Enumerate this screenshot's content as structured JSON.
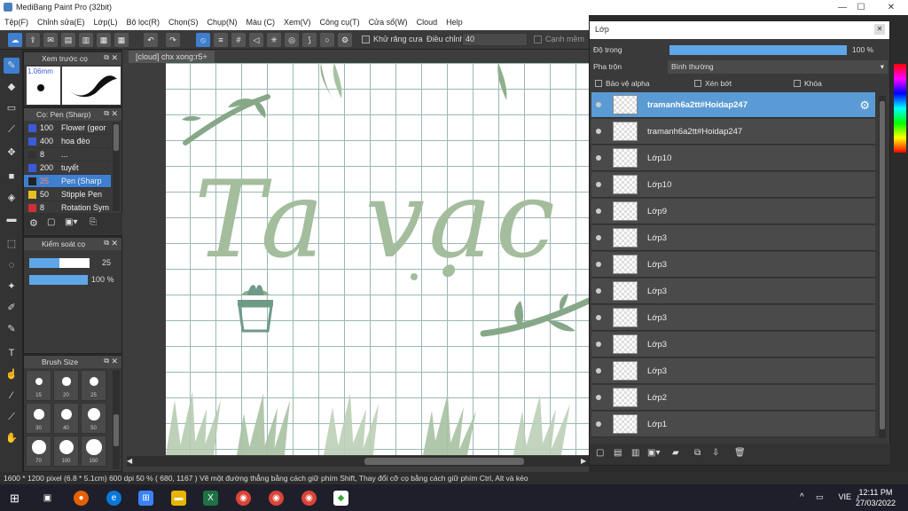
{
  "window": {
    "title": "MediBang Paint Pro (32bit)"
  },
  "menu": [
    "Tệp(F)",
    "Chỉnh sửa(E)",
    "Lớp(L)",
    "Bộ lọc(R)",
    "Chọn(S)",
    "Chụp(N)",
    "Màu (C)",
    "Xem(V)",
    "Công cụ(T)",
    "Cửa sổ(W)",
    "Cloud",
    "Help"
  ],
  "toolbar": {
    "antialias_label": "Khử răng cưa",
    "adjust_label": "Điều chỉnh",
    "adjust_value": "40",
    "smooth_label": "Cạnh mềm"
  },
  "preview_panel": {
    "title": "Xem trước cọ",
    "size": "1.06mm"
  },
  "brush_panel": {
    "title": "Cọ: Pen (Sharp)",
    "brushes": [
      {
        "size": "100",
        "name": "Flower (geor",
        "color": "#3a5bd9"
      },
      {
        "size": "400",
        "name": "hoa đèo",
        "color": "#3a5bd9"
      },
      {
        "size": "8",
        "name": "...",
        "color": "#333333"
      },
      {
        "size": "200",
        "name": "tuyết",
        "color": "#3a5bd9"
      },
      {
        "size": "25",
        "name": "Pen (Sharp",
        "color": "#222222"
      },
      {
        "size": "50",
        "name": "Stipple Pen",
        "color": "#e8c020"
      },
      {
        "size": "8",
        "name": "Rotation Sym",
        "color": "#d03030"
      }
    ]
  },
  "brush_control": {
    "title": "Kiểm soát cọ",
    "size": "25",
    "opacity": "100 %"
  },
  "brush_size_panel": {
    "title": "Brush Size",
    "sizes": [
      "15",
      "20",
      "25",
      "30",
      "40",
      "50",
      "70",
      "100",
      "150"
    ]
  },
  "canvas": {
    "tab": "[cloud] chx xong:r5+",
    "text": "Ta vạc lời"
  },
  "status": "1600 * 1200 pixel   (6.8 * 5.1cm)   600 dpi   50 %   ( 680, 1167 )   Vẽ một đường thẳng bằng cách giữ phím Shift, Thay đổi cỡ cọ bằng cách giữ phím Ctrl, Alt và kéo",
  "layer_panel": {
    "title": "Lớp",
    "opacity_label": "Độ trong",
    "opacity_value": "100 %",
    "blend_label": "Pha trộn",
    "blend_value": "Bình thường",
    "protect_alpha": "Bảo vệ alpha",
    "clipping": "Xén bớt",
    "lock": "Khóa",
    "layers": [
      "tramanh6a2tt#Hoidap247",
      "tramanh6a2tt#Hoidap247",
      "Lớp10",
      "Lớp10",
      "Lớp9",
      "Lớp3",
      "Lớp3",
      "Lớp3",
      "Lớp3",
      "Lớp3",
      "Lớp3",
      "Lớp2",
      "Lớp1"
    ]
  },
  "taskbar": {
    "time": "12:11 PM",
    "date": "27/03/2022",
    "lang": "VIE"
  }
}
